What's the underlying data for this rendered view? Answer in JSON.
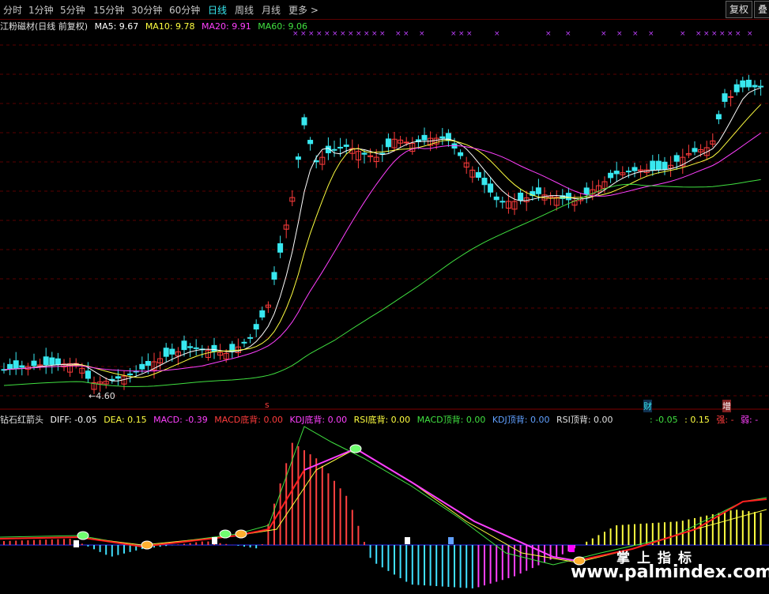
{
  "toolbar": {
    "timeframes": [
      "分时",
      "1分钟",
      "5分钟",
      "15分钟",
      "30分钟",
      "60分钟",
      "日线",
      "周线",
      "月线",
      "更多 >"
    ],
    "active_index": 6,
    "right_buttons": [
      "复权",
      "叠"
    ]
  },
  "main_legend": {
    "name": "江粉磁材(日线 前复权)",
    "ma5": "MA5: 9.67",
    "ma10": "MA10: 9.78",
    "ma20": "MA20: 9.91",
    "ma60": "MA60: 9.06"
  },
  "low_label": "←4.60",
  "markers": {
    "s": "s",
    "cai": "财",
    "zeng": "增"
  },
  "sub_legend": {
    "name": "钻石红箭头",
    "diff": "DIFF: -0.05",
    "dea": "DEA: 0.15",
    "macd": "MACD: -0.39",
    "macd_bottom": "MACD底背: 0.00",
    "kdj_bottom": "KDJ底背: 0.00",
    "rsi_bottom": "RSI底背: 0.00",
    "macd_top": "MACD顶背: 0.00",
    "kdj_top": "KDJ顶背: 0.00",
    "rsi_top": "RSI顶背: 0.00",
    "right_a": ": -0.05",
    "right_b": ": 0.15",
    "right_c": "强: -",
    "right_d": "弱: -"
  },
  "watermark": {
    "line1": "掌上指标",
    "line2": "www.palmindex.com"
  },
  "colors": {
    "up": "#ff3c3c",
    "down": "#38e8f0",
    "ma5": "#ffffff",
    "ma10": "#ffff40",
    "ma20": "#ff40ff",
    "ma60": "#40e040",
    "axis": "#800000"
  }
}
